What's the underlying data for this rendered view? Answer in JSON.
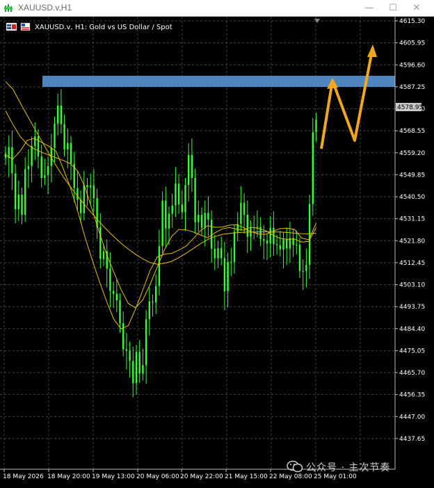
{
  "window": {
    "title": "XAUUSD.v,H1",
    "buttons": {
      "minimize": "—",
      "maximize": "☐",
      "close": "✕"
    }
  },
  "chart_header": {
    "text": "XAUUSD.v, H1:  Gold vs US Dollar / Spot"
  },
  "current_price": "4578.95",
  "watermark": "公众号 · 主次节奏",
  "colors": {
    "background": "#000000",
    "grid": "#3c4a3c",
    "candle": "#33ff33",
    "ma": "#e6c200",
    "zone": "#4d86bf",
    "arrow": "#f2a81d",
    "price_label_bg": "#c8c8c8"
  },
  "icons": [
    "app-icon",
    "minimize-icon",
    "maximize-icon",
    "close-icon",
    "flag-icon",
    "wechat-icon"
  ],
  "chart_data": {
    "type": "candlestick",
    "timeframe": "H1",
    "symbol": "XAUUSD.v",
    "ylim": [
      4432.0,
      4615.3
    ],
    "grid": true,
    "y_ticks": [
      "4615.30",
      "4605.95",
      "4596.60",
      "4587.25",
      "4577.90",
      "4568.55",
      "4559.20",
      "4549.85",
      "4540.50",
      "4531.15",
      "4521.80",
      "4512.45",
      "4503.10",
      "4493.75",
      "4484.40",
      "4475.05",
      "4465.70",
      "4456.35",
      "4447.00",
      "4437.65"
    ],
    "x_ticks": [
      "18 May 2026",
      "18 May 20:00",
      "19 May 13:00",
      "20 May 06:00",
      "20 May 22:00",
      "21 May 15:00",
      "22 May 08:00",
      "25 May 01:00"
    ],
    "close_series": [
      4556.9,
      4561.6,
      4550.4,
      4535.2,
      4541.4,
      4532.8,
      4552.2,
      4553.6,
      4562.1,
      4566.2,
      4557.6,
      4548.5,
      4549.7,
      4553.6,
      4561.3,
      4571.6,
      4579.3,
      4571.4,
      4560.6,
      4563.4,
      4554.6,
      4544.2,
      4539.2,
      4533.5,
      4545.5,
      4544.5,
      4545.3,
      4539.9,
      4527.5,
      4514.0,
      4517.3,
      4509.9,
      4500.4,
      4499.2,
      4496.4,
      4486.7,
      4475.6,
      4475.0,
      4470.7,
      4461.2,
      4474.5,
      4465.3,
      4468.9,
      4488.4,
      4496.0,
      4495.6,
      4502.5,
      4519.5,
      4538.8,
      4527.0,
      4533.3,
      4536.8,
      4546.1,
      4537.2,
      4533.9,
      4545.5,
      4558.3,
      4548.5,
      4529.7,
      4532.8,
      4527.3,
      4533.7,
      4530.7,
      4518.4,
      4514.3,
      4518.6,
      4514.4,
      4500.3,
      4512.7,
      4512.8,
      4525.6,
      4528.9,
      4538.0,
      4532.8,
      4523.5,
      4527.5,
      4527.3,
      4527.7,
      4522.5,
      4521.9,
      4520.6,
      4527.3,
      4520.3,
      4519.9,
      4518.1,
      4522.3,
      4518.5,
      4522.9,
      4520.0,
      4520.1,
      4508.9,
      4508.9,
      4511.5,
      4537.4,
      4567.9,
      4573.2
    ],
    "ma_series": [
      {
        "values": [
          4589.5,
          4586.3,
          4580.6,
          4575.0,
          4569.6,
          4564.2,
          4558.9,
          4553.7,
          4548.9,
          4544.6,
          4540.7,
          4536.9,
          4533.3,
          4529.8,
          4526.5,
          4523.5,
          4520.7,
          4518.2,
          4516.0,
          4514.1,
          4512.5,
          4511.8,
          4512.2,
          4513.0,
          4514.6,
          4516.5,
          4518.5,
          4520.6,
          4522.3,
          4523.6,
          4524.5,
          4524.9,
          4525.2,
          4525.4,
          4525.5,
          4525.5,
          4525.6,
          4525.5,
          4525.5,
          4525.3,
          4525.0,
          4524.8,
          4524.7,
          4525.0
        ]
      },
      {
        "values": [
          4577.0,
          4571.3,
          4566.2,
          4562.8,
          4560.8,
          4559.4,
          4558.2,
          4557.1,
          4555.9,
          4554.5,
          4551.4,
          4544.5,
          4534.9,
          4525.1,
          4516.0,
          4508.3,
          4501.0,
          4495.1,
          4493.3,
          4496.6,
          4503.1,
          4510.6,
          4517.9,
          4523.6,
          4526.6,
          4526.4,
          4525.5,
          4524.2,
          4523.1,
          4525.2,
          4526.8,
          4527.4,
          4526.7,
          4526.3,
          4527.6,
          4527.0,
          4526.1,
          4524.2,
          4522.8,
          4522.4,
          4522.5,
          4521.2,
          4521.5,
          4527.4
        ]
      },
      {
        "values": [
          4558.2,
          4556.5,
          4559.8,
          4564.5,
          4565.3,
          4563.6,
          4562.0,
          4559.8,
          4552.3,
          4544.2,
          4534.3,
          4523.3,
          4513.6,
          4504.4,
          4495.9,
          4488.3,
          4484.3,
          4485.7,
          4492.8,
          4500.8,
          4509.1,
          4514.9,
          4516.1,
          4516.4,
          4517.8,
          4519.5,
          4522.7,
          4526.1,
          4528.2,
          4527.5,
          4527.6,
          4528.4,
          4528.6,
          4527.3,
          4525.6,
          4524.7,
          4524.5,
          4525.7,
          4527.0,
          4527.1,
          4526.6,
          4522.9,
          4522.2,
          4529.3
        ]
      }
    ],
    "annotations": [
      "horizontal resistance zone",
      "projected zigzag arrow path"
    ]
  }
}
